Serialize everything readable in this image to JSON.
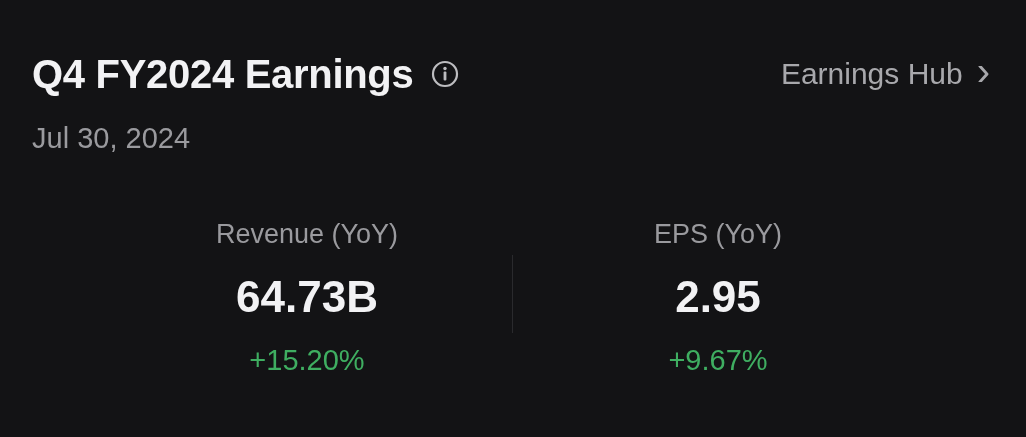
{
  "header": {
    "title": "Q4 FY2024 Earnings",
    "link": "Earnings Hub",
    "link_arrow": "›"
  },
  "date": "Jul 30, 2024",
  "metrics": [
    {
      "label": "Revenue (YoY)",
      "value": "64.73B",
      "change": "+15.20%",
      "color": "#3fae61"
    },
    {
      "label": "EPS (YoY)",
      "value": "2.95",
      "change": "+9.67%",
      "color": "#3fae61"
    }
  ]
}
